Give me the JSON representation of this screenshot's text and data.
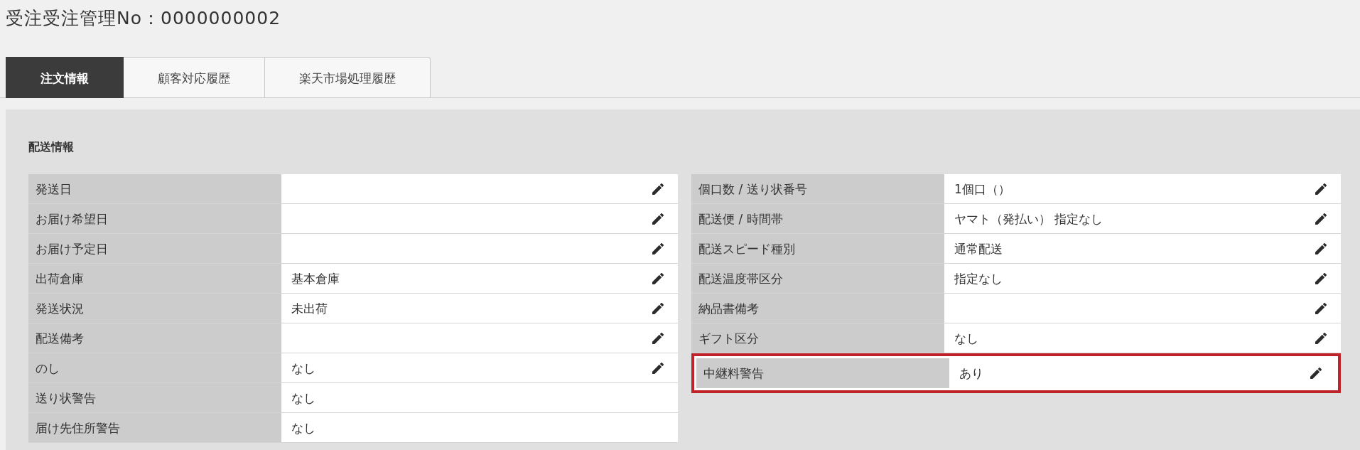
{
  "page_title": "受注受注管理No：0000000002",
  "tabs": [
    {
      "label": "注文情報",
      "selected": true
    },
    {
      "label": "顧客対応履歴",
      "selected": false
    },
    {
      "label": "楽天市場処理履歴",
      "selected": false
    }
  ],
  "shipping_info": {
    "heading": "配送情報",
    "left_rows": [
      {
        "label": "発送日",
        "editable": true,
        "highlighted": false
      },
      {
        "label": "お届け希望日",
        "editable": true,
        "highlighted": false
      },
      {
        "label": "お届け予定日",
        "editable": true,
        "highlighted": false
      },
      {
        "label": "出荷倉庫",
        "value": "基本倉庫",
        "editable": true,
        "highlighted": false
      },
      {
        "label": "発送状況",
        "value": "未出荷",
        "editable": true,
        "highlighted": false
      },
      {
        "label": "配送備考",
        "editable": true,
        "highlighted": false
      },
      {
        "label": "のし",
        "value": "なし",
        "editable": true,
        "highlighted": false
      },
      {
        "label": "送り状警告",
        "value": "なし",
        "editable": false,
        "highlighted": false
      },
      {
        "label": "届け先住所警告",
        "value": "なし",
        "editable": false,
        "highlighted": false
      }
    ],
    "right_rows": [
      {
        "label": "個口数 / 送り状番号",
        "value": "1個口（）",
        "editable": true,
        "highlighted": false
      },
      {
        "label": "配送便 / 時間帯",
        "value": "ヤマト（発払い） 指定なし",
        "editable": true,
        "highlighted": false
      },
      {
        "label": "配送スピード種別",
        "value": "通常配送",
        "editable": true,
        "highlighted": false
      },
      {
        "label": "配送温度帯区分",
        "value": "指定なし",
        "editable": true,
        "highlighted": false
      },
      {
        "label": "納品書備考",
        "editable": true,
        "highlighted": false
      },
      {
        "label": "ギフト区分",
        "value": "なし",
        "editable": true,
        "highlighted": false
      },
      {
        "label": "中継料警告",
        "value": "あり",
        "editable": true,
        "highlighted": true
      }
    ]
  }
}
